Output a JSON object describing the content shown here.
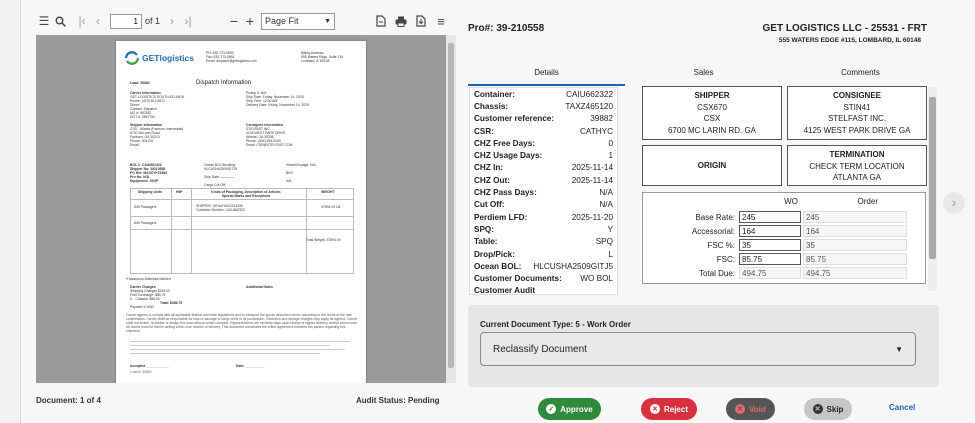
{
  "toolbar": {
    "page_value": "1",
    "page_of": "of 1",
    "zoom": "Page Fit"
  },
  "pdf": {
    "logo_text": "GETlogistics",
    "doc_title": "Dispatch Information"
  },
  "header": {
    "pro": "Pro#: 39-210558",
    "company": "GET LOGISTICS LLC - 25531 - FRT",
    "address": "555 WATERS EDGE #115, LOMBARD, IL 60148"
  },
  "tabs": [
    "Details",
    "Sales",
    "Comments"
  ],
  "details": [
    {
      "label": "Container:",
      "value": "CAIU662322"
    },
    {
      "label": "Chassis:",
      "value": "TAXZ465120"
    },
    {
      "label": "Customer reference:",
      "value": "39882"
    },
    {
      "label": "CSR:",
      "value": "CATHYC"
    },
    {
      "label": "CHZ Free Days:",
      "value": "0"
    },
    {
      "label": "CHZ Usage Days:",
      "value": "1"
    },
    {
      "label": "CHZ In:",
      "value": "2025-11-14"
    },
    {
      "label": "CHZ Out:",
      "value": "2025-11-14"
    },
    {
      "label": "CHZ Pass Days:",
      "value": "N/A"
    },
    {
      "label": "Cut Off:",
      "value": "N/A"
    },
    {
      "label": "Perdiem LFD:",
      "value": "2025-11-20"
    },
    {
      "label": "SPQ:",
      "value": "Y"
    },
    {
      "label": "Table:",
      "value": "SPQ"
    },
    {
      "label": "Drop/Pick:",
      "value": "L"
    },
    {
      "label": "Ocean BOL:",
      "value": "HLCUSHA2509GITJ5"
    },
    {
      "label": "Customer Documents:",
      "value": "WO BOL"
    },
    {
      "label": "Customer Audit",
      "value": ""
    }
  ],
  "shipper": {
    "title": "SHIPPER",
    "line1": "CSX670",
    "line2": "CSX",
    "line3": "6700 MC LARIN RD. GA"
  },
  "consignee": {
    "title": "CONSIGNEE",
    "line1": "STIN41",
    "line2": "STELFAST INC.",
    "line3": "4125 WEST PARK DRIVE GA"
  },
  "origin": {
    "title": "ORIGIN"
  },
  "termination": {
    "title": "TERMINATION",
    "line1": "CHECK TERM LOCATION",
    "line2": "ATLANTA GA"
  },
  "wo_table": {
    "col_wo": "WO",
    "col_order": "Order",
    "rows": [
      {
        "label": "Base Rate:",
        "wo": "245",
        "order": "245"
      },
      {
        "label": "Accessorial:",
        "wo": "164",
        "order": "164"
      },
      {
        "label": "FSC %:",
        "wo": "35",
        "order": "35"
      },
      {
        "label": "FSC:",
        "wo": "85.75",
        "order": "85.75"
      },
      {
        "label": "Total Due:",
        "wo": "494.75",
        "order": "494.75"
      }
    ]
  },
  "doc_type": {
    "label": "Current Document Type: 5 - Work Order",
    "select": "Reclassify Document"
  },
  "footer": {
    "document": "Document: 1 of 4",
    "audit": "Audit Status: Pending"
  },
  "buttons": {
    "approve": "Approve",
    "reject": "Reject",
    "void": "Void",
    "skip": "Skip",
    "cancel": "Cancel"
  }
}
